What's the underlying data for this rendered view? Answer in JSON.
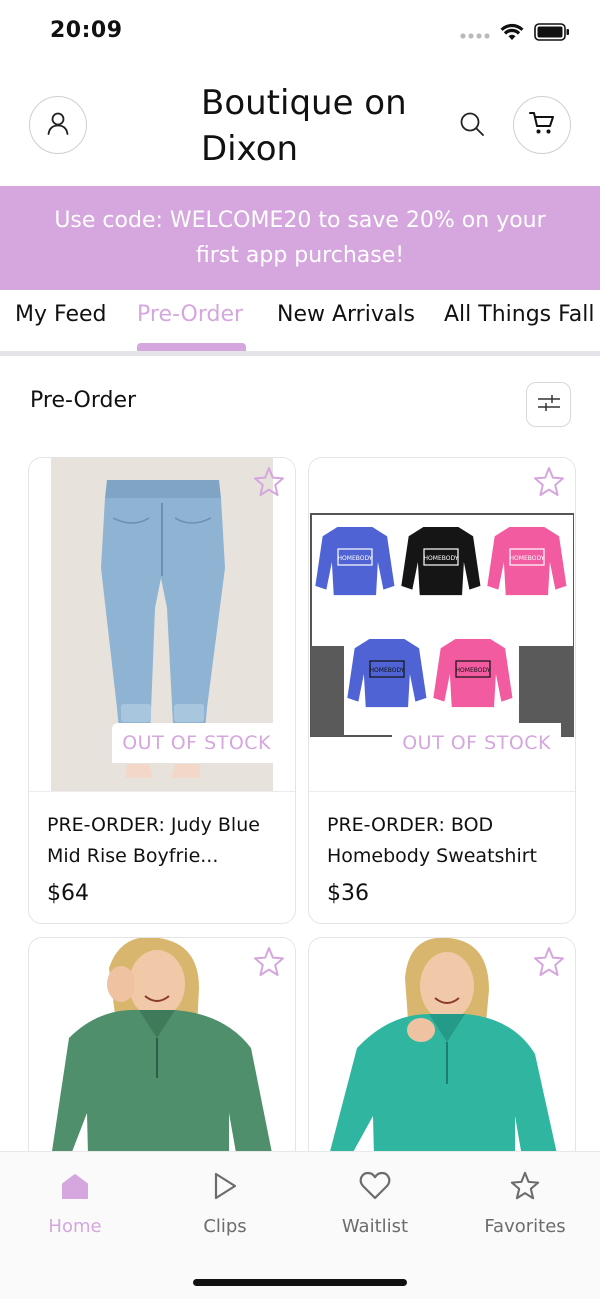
{
  "status_bar": {
    "time": "20:09"
  },
  "header": {
    "store_name": "Boutique on Dixon"
  },
  "promo": {
    "text": "Use code: WELCOME20 to save 20% on your first app purchase!"
  },
  "tabs": [
    {
      "label": "My Feed",
      "active": false
    },
    {
      "label": "Pre-Order",
      "active": true
    },
    {
      "label": "New Arrivals",
      "active": false
    },
    {
      "label": "All Things Fall",
      "active": false
    }
  ],
  "section": {
    "title": "Pre-Order"
  },
  "products": [
    {
      "title": "PRE-ORDER: Judy Blue Mid Rise Boyfrie...",
      "price": "$64",
      "badge": "OUT OF STOCK"
    },
    {
      "title": "PRE-ORDER: BOD Homebody Sweatshirt",
      "price": "$36",
      "badge": "OUT OF STOCK",
      "sweatshirt_label": "HOMEBODY"
    },
    {
      "title": "",
      "price": "",
      "badge": ""
    },
    {
      "title": "",
      "price": "",
      "badge": ""
    }
  ],
  "bottom_nav": [
    {
      "label": "Home",
      "icon": "home-icon",
      "active": true
    },
    {
      "label": "Clips",
      "icon": "play-icon",
      "active": false
    },
    {
      "label": "Waitlist",
      "icon": "heart-icon",
      "active": false
    },
    {
      "label": "Favorites",
      "icon": "star-icon",
      "active": false
    }
  ],
  "colors": {
    "accent": "#d5a7de",
    "divider": "#e3e5ea",
    "text": "#111111",
    "muted": "#6c6c6c"
  }
}
